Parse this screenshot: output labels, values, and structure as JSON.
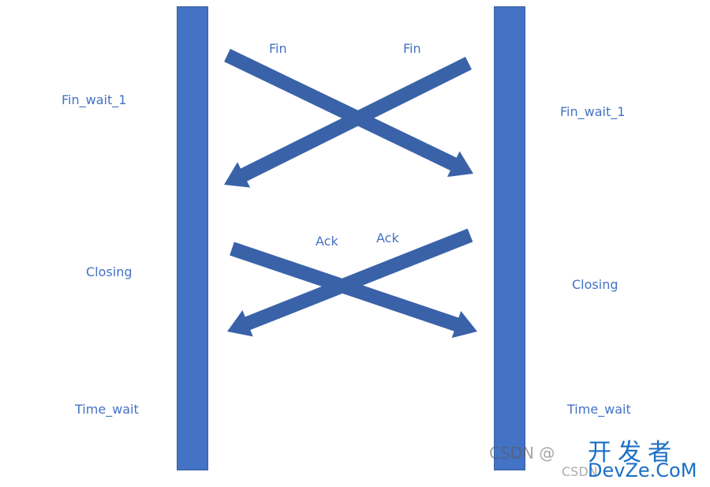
{
  "left_states": [
    "Fin_wait_1",
    "Closing",
    "Time_wait"
  ],
  "right_states": [
    "Fin_wait_1",
    "Closing",
    "Time_wait"
  ],
  "messages": [
    {
      "label": "Fin",
      "direction": "left-to-right"
    },
    {
      "label": "Fin",
      "direction": "right-to-left"
    },
    {
      "label": "Ack",
      "direction": "left-to-right"
    },
    {
      "label": "Ack",
      "direction": "right-to-left"
    }
  ],
  "colors": {
    "bar": "#4472c4",
    "arrow": "#3a62a8",
    "label": "#4472c4"
  },
  "watermark": {
    "line1": "CSDN @...",
    "brand_cn": "开发者",
    "brand_en": "DevZe.CoM"
  }
}
